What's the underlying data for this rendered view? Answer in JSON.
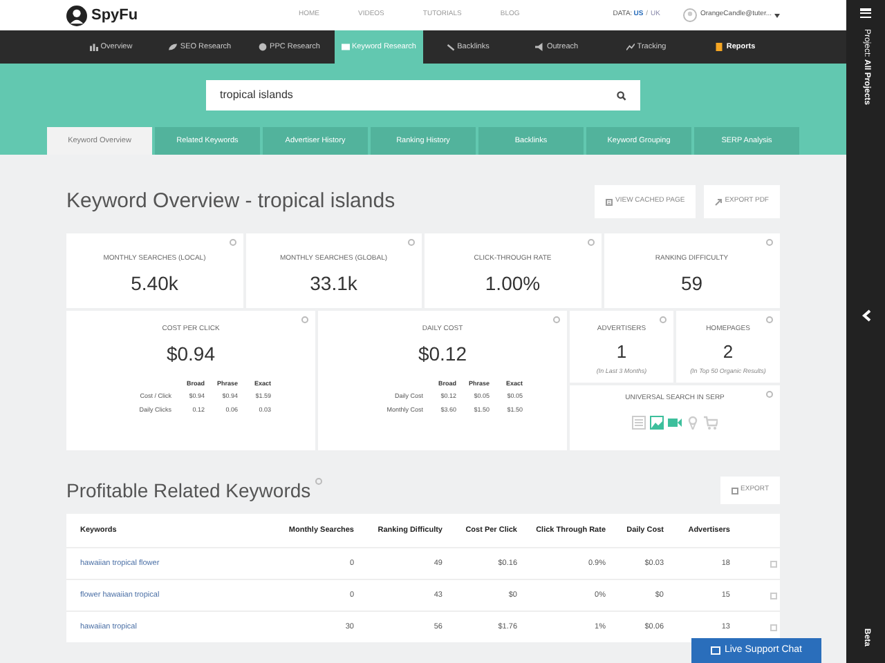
{
  "header": {
    "logo": "SpyFu",
    "nav_links": [
      "HOME",
      "VIDEOS",
      "TUTORIALS",
      "BLOG"
    ],
    "data_label": "DATA:",
    "data_separator": "/",
    "data_options": [
      {
        "label": "US",
        "selected": true
      },
      {
        "label": "UK",
        "selected": false
      }
    ],
    "user": "OrangeCandle@tuter..."
  },
  "main_nav": [
    {
      "label": "Overview",
      "kind": "chart",
      "selected": false,
      "highlighted": false
    },
    {
      "label": "SEO Research",
      "kind": "leaf",
      "selected": false,
      "highlighted": false
    },
    {
      "label": "PPC Research",
      "kind": "globe",
      "selected": false,
      "highlighted": false
    },
    {
      "label": "Keyword Research",
      "kind": "grid",
      "selected": true,
      "highlighted": false
    },
    {
      "label": "Backlinks",
      "kind": "link",
      "selected": false,
      "highlighted": false
    },
    {
      "label": "Outreach",
      "kind": "megaphone",
      "selected": false,
      "highlighted": false
    },
    {
      "label": "Tracking",
      "kind": "line",
      "selected": false,
      "highlighted": false
    },
    {
      "label": "Reports",
      "kind": "doc",
      "selected": false,
      "highlighted": true
    }
  ],
  "search": {
    "value": "tropical islands"
  },
  "tabs": [
    {
      "label": "Keyword Overview",
      "selected": true
    },
    {
      "label": "Related Keywords",
      "selected": false
    },
    {
      "label": "Advertiser History",
      "selected": false
    },
    {
      "label": "Ranking History",
      "selected": false
    },
    {
      "label": "Backlinks",
      "selected": false
    },
    {
      "label": "Keyword Grouping",
      "selected": false
    },
    {
      "label": "SERP Analysis",
      "selected": false
    }
  ],
  "overview": {
    "title": "Keyword Overview - tropical islands",
    "buttons": [
      {
        "label": "VIEW CACHED PAGE",
        "kind": "page"
      },
      {
        "label": "EXPORT PDF",
        "kind": "pdf"
      }
    ]
  },
  "metrics": [
    {
      "label": "MONTHLY SEARCHES (LOCAL)",
      "value": "5.40k"
    },
    {
      "label": "MONTHLY SEARCHES (GLOBAL)",
      "value": "33.1k"
    },
    {
      "label": "CLICK-THROUGH RATE",
      "value": "1.00%"
    },
    {
      "label": "RANKING DIFFICULTY",
      "value": "59"
    }
  ],
  "cost_cards": [
    {
      "label": "COST PER CLICK",
      "value": "$0.94",
      "columns": [
        "Broad",
        "Phrase",
        "Exact"
      ],
      "rows": [
        {
          "label": "Cost / Click",
          "values": [
            "$0.94",
            "$0.94",
            "$1.59"
          ]
        },
        {
          "label": "Daily Clicks",
          "values": [
            "0.12",
            "0.06",
            "0.03"
          ]
        }
      ]
    },
    {
      "label": "DAILY COST",
      "value": "$0.12",
      "columns": [
        "Broad",
        "Phrase",
        "Exact"
      ],
      "rows": [
        {
          "label": "Daily Cost",
          "values": [
            "$0.12",
            "$0.05",
            "$0.05"
          ]
        },
        {
          "label": "Monthly Cost",
          "values": [
            "$3.60",
            "$1.50",
            "$1.50"
          ]
        }
      ]
    }
  ],
  "small_cards": [
    {
      "label": "ADVERTISERS",
      "value": "1",
      "note": "(In Last 3 Months)"
    },
    {
      "label": "HOMEPAGES",
      "value": "2",
      "note": "(In Top 50 Organic Results)"
    }
  ],
  "universal_search": {
    "label": "UNIVERSAL SEARCH IN SERP",
    "items": [
      {
        "kind": "text",
        "active": false
      },
      {
        "kind": "image",
        "active": true
      },
      {
        "kind": "video",
        "active": true
      },
      {
        "kind": "map",
        "active": false
      },
      {
        "kind": "shopping",
        "active": false
      }
    ]
  },
  "related": {
    "title": "Profitable Related Keywords",
    "export": "EXPORT",
    "columns": [
      "Keywords",
      "Monthly Searches",
      "Ranking Difficulty",
      "Cost Per Click",
      "Click Through Rate",
      "Daily Cost",
      "Advertisers"
    ],
    "rows": [
      [
        "hawaiian tropical flower",
        "0",
        "49",
        "$0.16",
        "0.9%",
        "$0.03",
        "18"
      ],
      [
        "flower hawaiian tropical",
        "0",
        "43",
        "$0",
        "0%",
        "$0",
        "15"
      ],
      [
        "hawaiian tropical",
        "30",
        "56",
        "$1.76",
        "1%",
        "$0.06",
        "13"
      ]
    ]
  },
  "live_chat": "Live Support Chat",
  "sidebar": {
    "project_label": "Project:",
    "project_value": "All Projects",
    "beta": "Beta"
  }
}
